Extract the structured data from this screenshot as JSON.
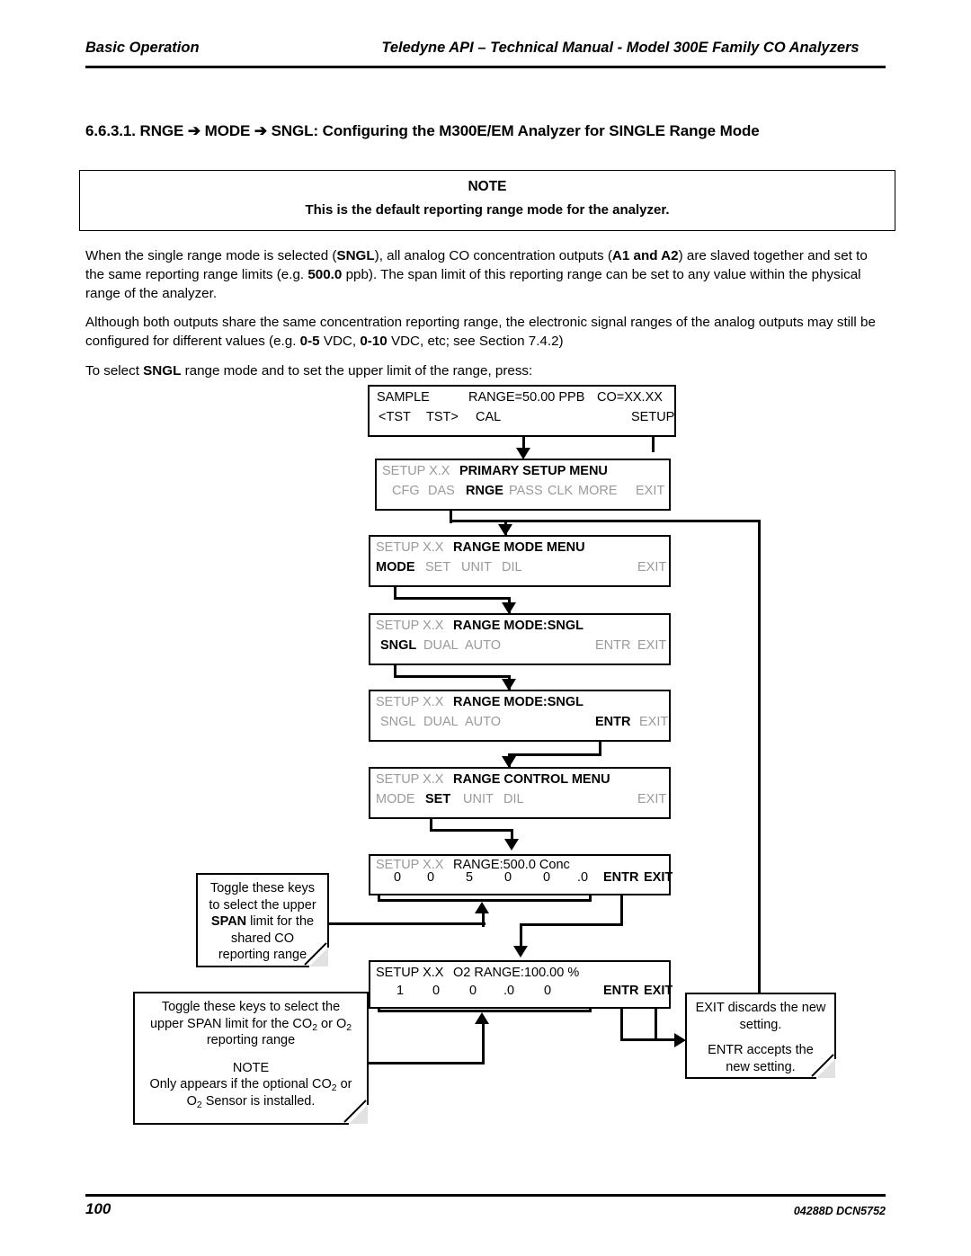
{
  "header": {
    "left": "Basic Operation",
    "right": "Teledyne API – Technical Manual - Model 300E Family CO Analyzers"
  },
  "section_title": "6.6.3.1. RNGE ➔ MODE ➔ SNGL: Configuring the M300E/EM Analyzer for SINGLE Range Mode",
  "note_box": {
    "title": "NOTE",
    "body": "This is the default reporting range mode for the analyzer."
  },
  "paragraphs": {
    "p1_a": "When the single range mode is selected (",
    "p1_b": "SNGL",
    "p1_c": "), all analog CO concentration outputs (",
    "p1_d": "A1 and A2",
    "p1_e": ") are slaved together and set to the same reporting range limits (e.g. ",
    "p1_f": "500.0",
    "p1_g": " ppb). The span limit of this reporting range can be set to any value within the physical range of the analyzer.",
    "p2_a": "Although both outputs share the same concentration reporting range, the electronic signal ranges of the analog outputs may still be configured for different values (e.g. ",
    "p2_b": "0-5",
    "p2_c": " VDC, ",
    "p2_d": "0-10",
    "p2_e": " VDC, etc; see Section 7.4.2)",
    "p3_a": "To select ",
    "p3_b": "SNGL",
    "p3_c": " range mode and to set the upper limit of the range, press:"
  },
  "displays": [
    {
      "id": "sample",
      "line1": [
        {
          "text": "SAMPLE",
          "style": "black"
        },
        {
          "text": "RANGE=50.00 PPB",
          "style": "black"
        },
        {
          "text": "CO=XX.XX",
          "style": "black"
        }
      ],
      "line2": [
        {
          "text": "<TST",
          "style": "black"
        },
        {
          "text": "TST>",
          "style": "black"
        },
        {
          "text": "CAL",
          "style": "black"
        },
        {
          "text": "SETUP",
          "style": "black-bold"
        }
      ]
    },
    {
      "id": "primary-setup-menu",
      "line1": [
        {
          "text": "SETUP X.X",
          "style": "gray"
        },
        {
          "text": "PRIMARY SETUP MENU",
          "style": "black-bold"
        }
      ],
      "line2": [
        {
          "text": "CFG",
          "style": "gray"
        },
        {
          "text": "DAS",
          "style": "gray"
        },
        {
          "text": "RNGE",
          "style": "black-bold"
        },
        {
          "text": "PASS",
          "style": "gray"
        },
        {
          "text": "CLK",
          "style": "gray"
        },
        {
          "text": "MORE",
          "style": "gray"
        },
        {
          "text": "EXIT",
          "style": "gray"
        }
      ]
    },
    {
      "id": "range-mode-menu",
      "line1": [
        {
          "text": "SETUP X.X",
          "style": "gray"
        },
        {
          "text": "RANGE MODE MENU",
          "style": "black-bold"
        }
      ],
      "line2": [
        {
          "text": "MODE",
          "style": "black-bold"
        },
        {
          "text": "SET",
          "style": "gray"
        },
        {
          "text": "UNIT",
          "style": "gray"
        },
        {
          "text": "DIL",
          "style": "gray"
        },
        {
          "text": "EXIT",
          "style": "gray"
        }
      ]
    },
    {
      "id": "range-mode-sngl-select",
      "line1": [
        {
          "text": "SETUP X.X",
          "style": "gray"
        },
        {
          "text": "RANGE MODE:SNGL",
          "style": "black-bold"
        }
      ],
      "line2": [
        {
          "text": "SNGL",
          "style": "black-bold"
        },
        {
          "text": "DUAL",
          "style": "gray"
        },
        {
          "text": "AUTO",
          "style": "gray"
        },
        {
          "text": "ENTR",
          "style": "gray"
        },
        {
          "text": "EXIT",
          "style": "gray"
        }
      ]
    },
    {
      "id": "range-mode-sngl-entr",
      "line1": [
        {
          "text": "SETUP X.X",
          "style": "gray"
        },
        {
          "text": "RANGE MODE:SNGL",
          "style": "black-bold"
        }
      ],
      "line2": [
        {
          "text": "SNGL",
          "style": "gray"
        },
        {
          "text": "DUAL",
          "style": "gray"
        },
        {
          "text": "AUTO",
          "style": "gray"
        },
        {
          "text": "ENTR",
          "style": "black-bold"
        },
        {
          "text": "EXIT",
          "style": "gray"
        }
      ]
    },
    {
      "id": "range-control-menu",
      "line1": [
        {
          "text": "SETUP X.X",
          "style": "gray"
        },
        {
          "text": "RANGE CONTROL MENU",
          "style": "black-bold"
        }
      ],
      "line2": [
        {
          "text": "MODE",
          "style": "gray"
        },
        {
          "text": "SET",
          "style": "black-bold"
        },
        {
          "text": "UNIT",
          "style": "gray"
        },
        {
          "text": "DIL",
          "style": "gray"
        },
        {
          "text": "EXIT",
          "style": "gray"
        }
      ]
    },
    {
      "id": "range-conc-entry",
      "line1": [
        {
          "text": "SETUP X.X",
          "style": "gray"
        },
        {
          "text": "RANGE:500.0 Conc",
          "style": "black"
        }
      ],
      "line2": [
        {
          "text": "0",
          "style": "black"
        },
        {
          "text": "0",
          "style": "black"
        },
        {
          "text": "5",
          "style": "black"
        },
        {
          "text": "0",
          "style": "black"
        },
        {
          "text": "0",
          "style": "black"
        },
        {
          "text": ".0",
          "style": "black"
        },
        {
          "text": "ENTR",
          "style": "black-bold"
        },
        {
          "text": "EXIT",
          "style": "black-bold"
        }
      ]
    },
    {
      "id": "o2-range-entry",
      "line1": [
        {
          "text": "SETUP X.X",
          "style": "black"
        },
        {
          "text": "O2 RANGE:100.00 %",
          "style": "black"
        }
      ],
      "line2": [
        {
          "text": "1",
          "style": "black"
        },
        {
          "text": "0",
          "style": "black"
        },
        {
          "text": "0",
          "style": "black"
        },
        {
          "text": ".0",
          "style": "black"
        },
        {
          "text": "0",
          "style": "black"
        },
        {
          "text": "ENTR",
          "style": "black-bold"
        },
        {
          "text": "EXIT",
          "style": "black-bold"
        }
      ]
    }
  ],
  "callouts": {
    "co_span": {
      "l1": "Toggle these keys",
      "l2": "to select the upper",
      "l3a": "SPAN",
      "l3b": " limit for the",
      "l4": "shared CO",
      "l5": "reporting range"
    },
    "o2_span": {
      "l1": "Toggle these keys to select the",
      "l2a": "upper SPAN limit for the CO",
      "l2b": "2",
      "l2c": " or O",
      "l2d": "2",
      "l3": "reporting range",
      "note_title": "NOTE",
      "l4a": "Only appears if the optional CO",
      "l4b": "2",
      "l4c": " or",
      "l5a": "O",
      "l5b": "2",
      "l5c": " Sensor is installed."
    },
    "entr_exit": {
      "l1": "EXIT discards the new",
      "l2": "setting.",
      "l3": "ENTR accepts the",
      "l4": "new setting."
    }
  },
  "footer": {
    "page_number": "100",
    "doc_id": "04288D DCN5752"
  }
}
